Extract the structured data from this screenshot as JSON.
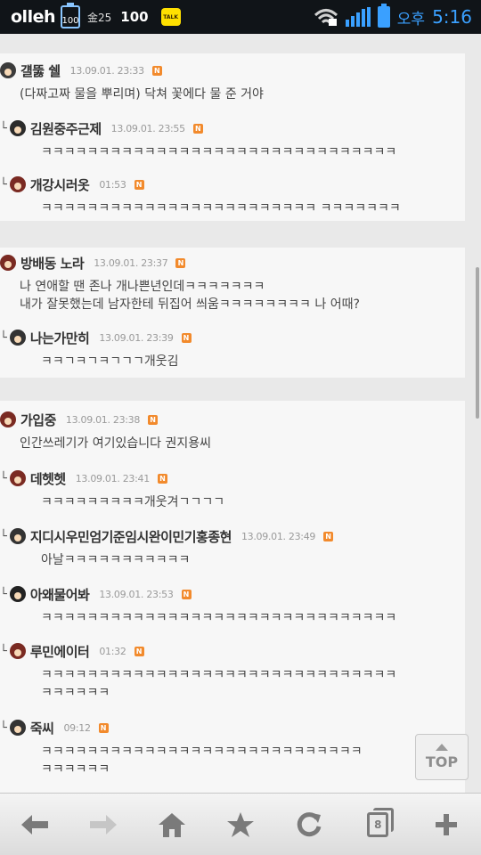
{
  "status_bar": {
    "carrier": "olleh",
    "battery_small": "100",
    "temp": "金25",
    "battery_text": "100",
    "talk_icon": "TALK",
    "ampm": "오후",
    "time": "5:16",
    "colors": {
      "accent": "#3aa0ff",
      "background": "#101418"
    },
    "icons": [
      "wifi-lock-icon",
      "signal-icon",
      "battery-charging-icon"
    ]
  },
  "groups": [
    {
      "comments": [
        {
          "name": "걜뚫 쉘",
          "time": "13.09.01. 23:33",
          "badge": "N",
          "reply": false,
          "text": "(다짜고짜 물을 뿌리며) 닥쳐 꽃에다 물 준 거야",
          "avatar_color": "#3b3b3b"
        },
        {
          "name": "김원중주근제",
          "time": "13.09.01. 23:55",
          "badge": "N",
          "reply": true,
          "text": "ㅋㅋㅋㅋㅋㅋㅋㅋㅋㅋㅋㅋㅋㅋㅋㅋㅋㅋㅋㅋㅋㅋㅋㅋㅋㅋㅋㅋㅋㅋㅋ",
          "avatar_color": "#2b2b2b"
        },
        {
          "name": "개강시러옷",
          "time": "01:53",
          "badge": "N",
          "reply": true,
          "text": "ㅋㅋㅋㅋㅋㅋㅋㅋㅋㅋㅋㅋㅋㅋㅋㅋㅋㅋㅋㅋㅋㅋㅋㅋ ㅋㅋㅋㅋㅋㅋㅋ",
          "avatar_color": "#7a2a22"
        }
      ]
    },
    {
      "comments": [
        {
          "name": "방배동 노라",
          "time": "13.09.01. 23:37",
          "badge": "N",
          "reply": false,
          "text": "나 연애할 땐 존나 개나쁜년인데ㅋㅋㅋㅋㅋㅋㅋ\n내가 잘못했는데 남자한테 뒤집어 씌움ㅋㅋㅋㅋㅋㅋㅋㅋ 나 어때?",
          "avatar_color": "#7a2a22"
        },
        {
          "name": "나는가만히",
          "time": "13.09.01. 23:39",
          "badge": "N",
          "reply": true,
          "text": "ㅋㅋㄱㅋㄱㅋㄱㄱㄱ개웃김",
          "avatar_color": "#333333"
        }
      ]
    },
    {
      "comments": [
        {
          "name": "가입중",
          "time": "13.09.01. 23:38",
          "badge": "N",
          "reply": false,
          "text": "인간쓰레기가 여기있습니다 권지용씨",
          "avatar_color": "#7a2a22"
        },
        {
          "name": "데헷헷",
          "time": "13.09.01. 23:41",
          "badge": "N",
          "reply": true,
          "text": "ㅋㅋㅋㅋㅋㅋㅋㅋㅋ개웃겨ㄱㄱㄱㄱ",
          "avatar_color": "#7a2a22"
        },
        {
          "name": "지디시우민엄기준임시완이민기홍종현",
          "time": "13.09.01. 23:49",
          "badge": "N",
          "reply": true,
          "text": "아날ㅋㅋㅋㅋㅋㅋㅋㅋㅋㅋㅋ",
          "avatar_color": "#333333"
        },
        {
          "name": "아왜물어봐",
          "time": "13.09.01. 23:53",
          "badge": "N",
          "reply": true,
          "text": "ㅋㅋㅋㅋㅋㅋㅋㅋㅋㅋㅋㅋㅋㅋㅋㅋㅋㅋㅋㅋㅋㅋㅋㅋㅋㅋㅋㅋㅋㅋㅋ",
          "avatar_color": "#222222"
        },
        {
          "name": "루민에이터",
          "time": "01:32",
          "badge": "N",
          "reply": true,
          "text": "ㅋㅋㅋㅋㅋㅋㅋㅋㅋㅋㅋㅋㅋㅋㅋㅋㅋㅋㅋㅋㅋㅋㅋㅋㅋㅋㅋㅋㅋㅋㅋ\nㅋㅋㅋㅋㅋㅋ",
          "avatar_color": "#7a2a22"
        },
        {
          "name": "죽씨",
          "time": "09:12",
          "badge": "N",
          "reply": true,
          "text": "ㅋㅋㅋㅋㅋㅋㅋㅋㅋㅋㅋㅋㅋㅋㅋㅋㅋㅋㅋㅋㅋㅋㅋㅋㅋㅋㅋㅋ\nㅋㅋㅋㅋㅋㅋ",
          "avatar_color": "#333333"
        }
      ]
    }
  ],
  "top_button": {
    "label": "TOP"
  },
  "toolbar": {
    "items": [
      {
        "icon": "back-arrow-icon",
        "glyph": "⇐",
        "enabled": true
      },
      {
        "icon": "forward-arrow-icon",
        "glyph": "⇒",
        "enabled": false
      },
      {
        "icon": "home-icon",
        "glyph": "⌂",
        "enabled": true
      },
      {
        "icon": "bookmark-star-icon",
        "glyph": "★",
        "enabled": true
      },
      {
        "icon": "refresh-icon",
        "glyph": "↻",
        "enabled": true
      },
      {
        "icon": "tabs-icon",
        "glyph": "",
        "enabled": true
      },
      {
        "icon": "add-icon",
        "glyph": "+",
        "enabled": true
      }
    ],
    "tab_count": "8"
  }
}
